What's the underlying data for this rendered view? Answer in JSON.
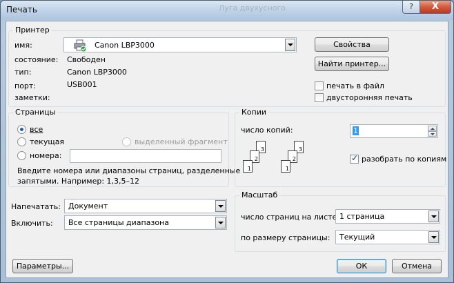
{
  "window": {
    "title": "Печать",
    "background_ghost_title": "Луга двуxусного",
    "help_button": "?",
    "close_button": "X"
  },
  "printer": {
    "group_title": "Принтер",
    "name_label": "имя:",
    "name_value": "Canon LBP3000",
    "status_label": "состояние:",
    "status_value": "Свободен",
    "type_label": "тип:",
    "type_value": "Canon LBP3000",
    "port_label": "порт:",
    "port_value": "USB001",
    "notes_label": "заметки:",
    "properties_button": "Свойства",
    "find_printer_button": "Найти принтер...",
    "print_to_file_label": "печать в файл",
    "print_to_file_checked": false,
    "duplex_label": "двусторонняя печать",
    "duplex_checked": false
  },
  "pages": {
    "group_title": "Страницы",
    "all_label": "все",
    "current_label": "текущая",
    "selection_label": "выделенный фрагмент",
    "numbers_label": "номера:",
    "numbers_value": "",
    "selected_option": "все",
    "hint_line1": "Введите номера или диапазоны страниц, разделенные",
    "hint_line2": "запятыми. Например: 1,3,5–12"
  },
  "print_what": {
    "label": "Напечатать:",
    "value": "Документ"
  },
  "include": {
    "label": "Включить:",
    "value": "Все страницы диапазона"
  },
  "copies": {
    "group_title": "Копии",
    "count_label": "число копий:",
    "count_value": "1",
    "collate_label": "разобрать по копиям",
    "collate_checked": true,
    "page_numbers": [
      "1",
      "2",
      "3"
    ]
  },
  "scale": {
    "group_title": "Масштаб",
    "pages_per_sheet_label": "число страниц на листе:",
    "pages_per_sheet_value": "1 страница",
    "fit_to_label": "по размеру страницы:",
    "fit_to_value": "Текущий"
  },
  "footer": {
    "options_button": "Параметры...",
    "ok_button": "ОК",
    "cancel_button": "Отмена"
  },
  "colors": {
    "accent": "#3c7fb1",
    "close_red": "#c1361b",
    "selection_blue": "#3399ff"
  }
}
